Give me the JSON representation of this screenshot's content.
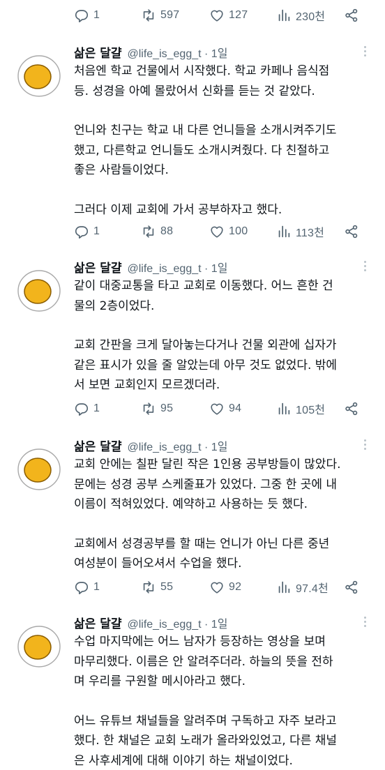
{
  "author": {
    "name": "삶은 달걀",
    "handle": "@life_is_egg_t",
    "dot": " · ",
    "time": "1일"
  },
  "top_actions": {
    "replies": "1",
    "retweets": "597",
    "likes": "127",
    "views": "230천"
  },
  "tweets": [
    {
      "paragraphs": [
        [
          "처음엔 학교 건물에서 시작했다. 학교 카페나 음식점",
          "등. 성경을 아예 몰랐어서 신화를 듣는 것 같았다."
        ],
        [
          "언니와 친구는 학교 내 다른 언니들을 소개시켜주기도",
          "했고, 다른학교 언니들도 소개시켜줬다. 다 친절하고",
          "좋은 사람들이었다."
        ],
        [
          "그러다 이제 교회에 가서 공부하자고 했다."
        ]
      ],
      "actions": {
        "replies": "1",
        "retweets": "88",
        "likes": "100",
        "views": "113천"
      }
    },
    {
      "paragraphs": [
        [
          "같이 대중교통을 타고 교회로 이동했다. 어느 흔한 건",
          "물의 2층이었다."
        ],
        [
          "교회 간판을 크게 달아놓는다거나 건물 외관에 십자가",
          "같은 표시가 있을 줄 알았는데 아무 것도 없었다. 밖에",
          "서 보면 교회인지 모르겠더라."
        ]
      ],
      "actions": {
        "replies": "1",
        "retweets": "95",
        "likes": "94",
        "views": "105천"
      }
    },
    {
      "paragraphs": [
        [
          "교회 안에는 칠판 달린 작은 1인용 공부방들이 많았다.",
          "문에는 성경 공부 스케줄표가 있었다. 그중 한 곳에 내",
          "이름이 적혀있었다. 예약하고 사용하는 듯 했다."
        ],
        [
          "교회에서 성경공부를 할 때는 언니가 아닌 다른 중년",
          "여성분이 들어오셔서 수업을 했다."
        ]
      ],
      "actions": {
        "replies": "1",
        "retweets": "55",
        "likes": "92",
        "views": "97.4천"
      }
    },
    {
      "paragraphs": [
        [
          "수업 마지막에는 어느 남자가 등장하는 영상을 보며",
          "마무리했다. 이름은 안 알려주더라. 하늘의 뜻을 전하",
          "며 우리를 구원할 메시아라고 했다."
        ],
        [
          "어느 유튜브 채널들을 알려주며 구독하고 자주 보라고",
          "했다. 한 채널은 교회 노래가 올라와있었고, 다른 채널",
          "은 사후세계에 대해 이야기 하는 채널이었다."
        ]
      ]
    }
  ],
  "colors": {
    "text": "#0f1419",
    "secondary": "#536471",
    "yolk": "#f2b41c",
    "egg_white": "#ffffff"
  }
}
